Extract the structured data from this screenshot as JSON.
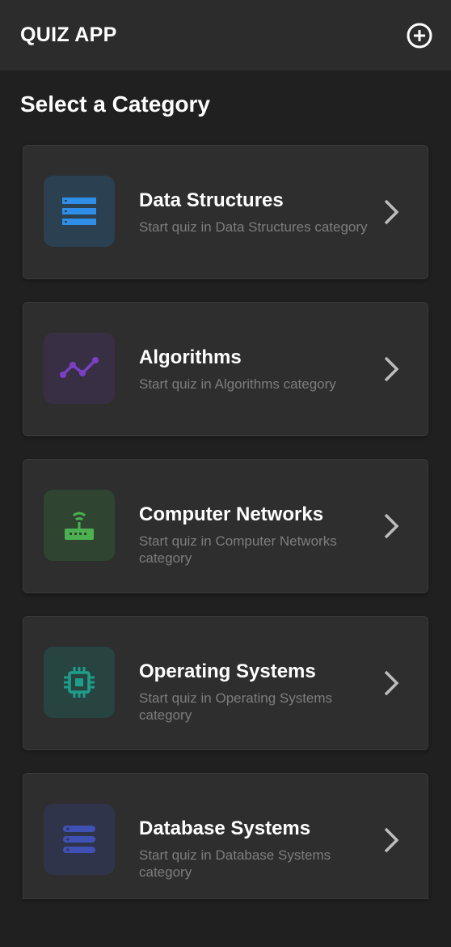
{
  "app": {
    "title": "QUIZ APP",
    "add_icon": "add-circle-icon"
  },
  "heading": "Select a Category",
  "categories": [
    {
      "title": "Data Structures",
      "subtitle": "Start quiz in Data Structures category",
      "icon": "list-icon",
      "color": "#2f8fe8",
      "bg": "#2b4050"
    },
    {
      "title": "Algorithms",
      "subtitle": "Start quiz in Algorithms category",
      "icon": "line-graph-icon",
      "color": "#7b3fc4",
      "bg": "#382f45"
    },
    {
      "title": "Computer Networks",
      "subtitle": "Start quiz in Computer Networks category",
      "icon": "router-icon",
      "color": "#4cb050",
      "bg": "#2f4532"
    },
    {
      "title": "Operating Systems",
      "subtitle": "Start quiz in Operating Systems category",
      "icon": "chip-icon",
      "color": "#1e9e8a",
      "bg": "#274440"
    },
    {
      "title": "Database Systems",
      "subtitle": "Start quiz in Database Systems category",
      "icon": "storage-icon",
      "color": "#3f51b5",
      "bg": "#30344a"
    }
  ]
}
